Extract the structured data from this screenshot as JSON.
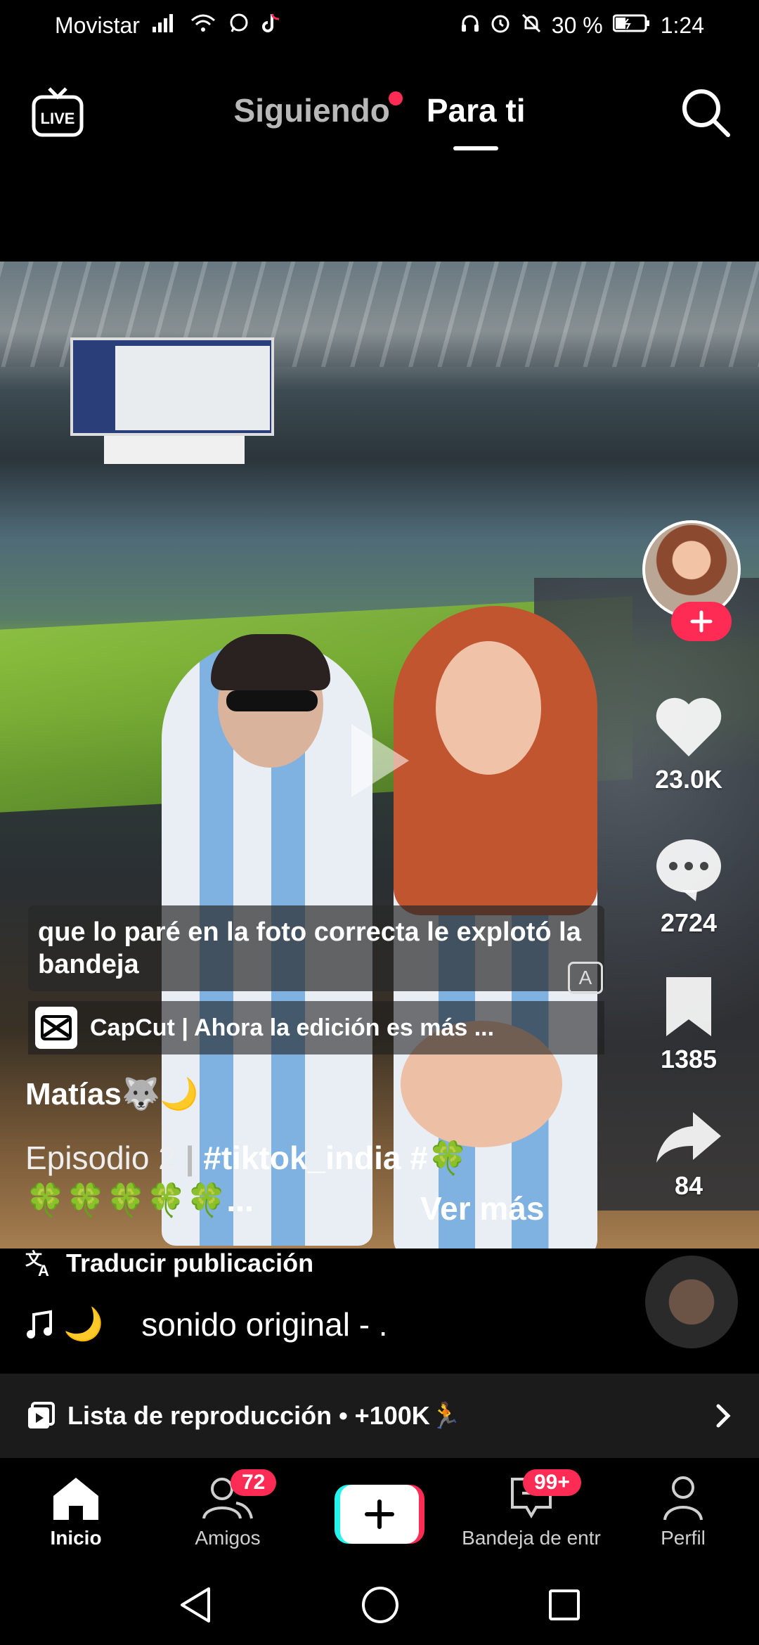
{
  "status_bar": {
    "carrier": "Movistar",
    "battery_percent": "30 %",
    "time": "1:24"
  },
  "top_nav": {
    "live_label": "LIVE",
    "tab_following": "Siguiendo",
    "tab_for_you": "Para ti",
    "active_tab": "Para ti"
  },
  "video": {
    "overlay_caption": "que lo paré en la foto correcta le explotó la bandeja",
    "capcut_text": "CapCut | Ahora la edición es más ...",
    "author": "Matías🐺🌙",
    "description_episode": "Episodio 2",
    "description_tags": "#tiktok_india #🍀",
    "description_line2": "🍀🍀🍀🍀🍀...",
    "see_more": "Ver más"
  },
  "actions": {
    "likes": "23.0K",
    "comments": "2724",
    "saves": "1385",
    "shares": "84"
  },
  "translate_label": "Traducir publicación",
  "sound": {
    "emoji": "🌙",
    "text": "sonido original - ."
  },
  "playlist": {
    "label": "Lista de reproducción • +100K🏃"
  },
  "bottom_nav": {
    "home": "Inicio",
    "friends": "Amigos",
    "friends_badge": "72",
    "inbox": "Bandeja de entr",
    "inbox_badge": "99+",
    "profile": "Perfil"
  },
  "colors": {
    "accent": "#fe2c55",
    "cyan": "#25f4ee",
    "background": "#000000"
  }
}
